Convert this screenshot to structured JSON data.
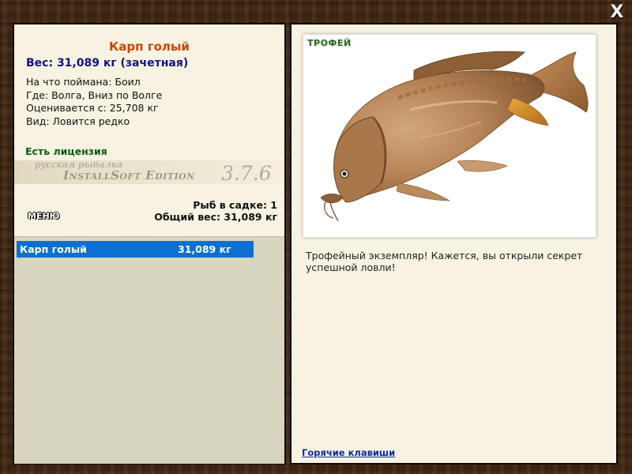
{
  "close_label": "X",
  "fish": {
    "name": "Карп голый",
    "weight_line": "Вес: 31,089 кг (зачетная)",
    "bait_line": "На что поймана: Боил",
    "location_line": "Где: Волга, Вниз по Волге",
    "valued_line": "Оценивается с: 25,708 кг",
    "species_line": "Вид: Ловится редко"
  },
  "license_text": "Есть лицензия",
  "banner": {
    "subtitle": "русская рыбалка",
    "title": "InstallSoft Edition",
    "version": "3.7.6"
  },
  "menu_label": "МЕНЮ",
  "keepnet": {
    "count_line": "Рыб в садке: 1",
    "total_line": "Общий вес: 31,089 кг",
    "items": [
      {
        "name": "Карп голый",
        "weight": "31,089 кг",
        "selected": true
      }
    ]
  },
  "photo": {
    "badge": "ТРОФЕЙ",
    "icon": "carp-fish-image"
  },
  "description": "Трофейный экземпляр! Кажется, вы открыли секрет успешной ловли!",
  "hotkeys_link": "Горячие клавиши",
  "colors": {
    "title": "#c8460c",
    "weight": "#14147e",
    "license": "#0d5f0d",
    "selection": "#0d6fd0",
    "link": "#0b2ea6"
  }
}
